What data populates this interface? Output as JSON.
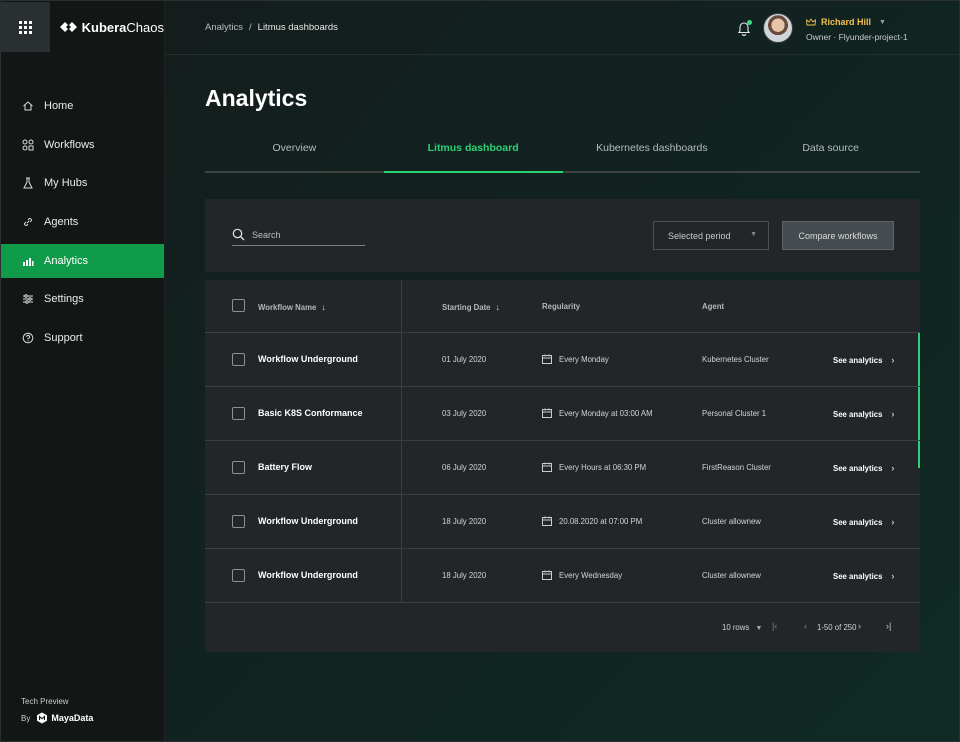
{
  "brand": {
    "name_bold": "Kubera",
    "name_light": "Chaos"
  },
  "sidebar": {
    "items": [
      {
        "label": "Home",
        "icon": "home-icon"
      },
      {
        "label": "Workflows",
        "icon": "workflows-icon"
      },
      {
        "label": "My Hubs",
        "icon": "flask-icon"
      },
      {
        "label": "Agents",
        "icon": "link-icon"
      },
      {
        "label": "Analytics",
        "icon": "analytics-icon",
        "active": true
      },
      {
        "label": "Settings",
        "icon": "settings-icon"
      },
      {
        "label": "Support",
        "icon": "help-icon"
      }
    ],
    "footer": {
      "tech_preview": "Tech Preview",
      "by": "By",
      "company": "MayaData"
    }
  },
  "topbar": {
    "breadcrumb": {
      "parent": "Analytics",
      "separator": "/",
      "current": "Litmus dashboards"
    },
    "user": {
      "name": "Richard Hill",
      "role": "Owner · Flyunder-project-1"
    },
    "notification_dot_color": "#3ddc84"
  },
  "page": {
    "title": "Analytics",
    "tabs": [
      {
        "label": "Overview"
      },
      {
        "label": "Litmus dashboard",
        "active": true
      },
      {
        "label": "Kubernetes dashboards"
      },
      {
        "label": "Data source"
      }
    ]
  },
  "filters": {
    "search_placeholder": "Search",
    "period_label": "Selected period",
    "compare_label": "Compare workflows"
  },
  "table": {
    "columns": {
      "workflow_name": "Workflow Name",
      "starting_date": "Starting Date",
      "regularity": "Regularity",
      "agent": "Agent"
    },
    "sort_arrow": "↓",
    "rows": [
      {
        "name": "Workflow Underground",
        "date": "01 July 2020",
        "regularity": "Every Monday",
        "agent": "Kubernetes Cluster",
        "action": "See analytics"
      },
      {
        "name": "Basic K8S Conformance",
        "date": "03 July 2020",
        "regularity": "Every Monday at 03:00 AM",
        "agent": "Personal Cluster 1",
        "action": "See analytics"
      },
      {
        "name": "Battery Flow",
        "date": "06 July 2020",
        "regularity": "Every Hours at 06:30 PM",
        "agent": "FirstReason Cluster",
        "action": "See analytics"
      },
      {
        "name": "Workflow Underground",
        "date": "18 July 2020",
        "regularity": "20.08.2020 at 07:00 PM",
        "agent": "Cluster allownew",
        "action": "See analytics"
      },
      {
        "name": "Workflow Underground",
        "date": "18 July 2020",
        "regularity": "Every Wednesday",
        "agent": "Cluster allownew",
        "action": "See analytics"
      }
    ]
  },
  "pagination": {
    "rows_label": "10 rows",
    "range_label": "1-50 of 250"
  },
  "colors": {
    "accent": "#2bd374",
    "nav_active": "#109b4a",
    "user_name": "#f2c14e"
  }
}
